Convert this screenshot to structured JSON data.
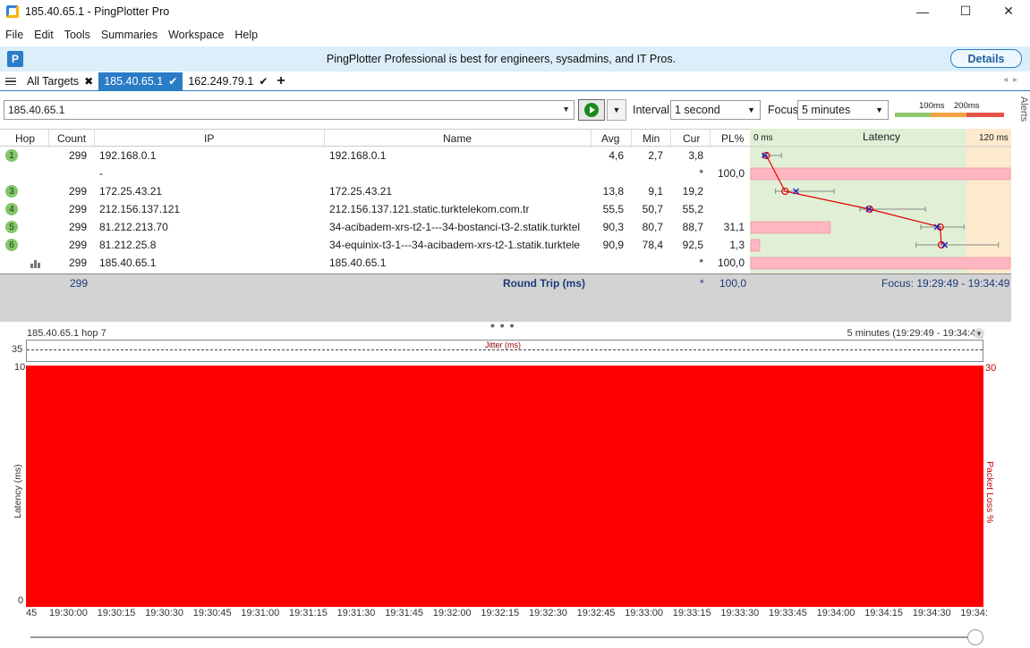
{
  "window": {
    "title": "185.40.65.1 - PingPlotter Pro",
    "minimize": "—",
    "maximize": "☐",
    "close": "✕"
  },
  "menu": [
    "File",
    "Edit",
    "Tools",
    "Summaries",
    "Workspace",
    "Help"
  ],
  "banner": {
    "text": "PingPlotter Professional is best for engineers, sysadmins, and IT Pros.",
    "button": "Details"
  },
  "tabs": {
    "all_targets": "All Targets",
    "items": [
      {
        "label": "185.40.65.1",
        "active": true
      },
      {
        "label": "162.249.79.1",
        "active": false
      }
    ],
    "add": "+"
  },
  "toolbar": {
    "target_value": "185.40.65.1",
    "interval_label": "Interval",
    "interval_value": "1 second",
    "focus_label": "Focus",
    "focus_value": "5 minutes",
    "scale_100": "100ms",
    "scale_200": "200ms",
    "alerts": "Alerts"
  },
  "columns": {
    "hop": "Hop",
    "count": "Count",
    "ip": "IP",
    "name": "Name",
    "avg": "Avg",
    "min": "Min",
    "cur": "Cur",
    "pl": "PL%",
    "latency": "Latency",
    "lat_min": "0 ms",
    "lat_max": "120 ms"
  },
  "rows": [
    {
      "hop": "1",
      "count": "299",
      "ip": "192.168.0.1",
      "name": "192.168.0.1",
      "avg": "4,6",
      "min": "2,7",
      "cur": "3,8",
      "pl": "",
      "avg_ms": 4.6,
      "min_ms": 2.7,
      "cur_ms": 3.8,
      "max_ms": 12,
      "pl_pct": 0
    },
    {
      "hop": "",
      "count": "",
      "ip": "-",
      "name": "",
      "avg": "",
      "min": "",
      "cur": "*",
      "pl": "100,0",
      "pl_pct": 100
    },
    {
      "hop": "3",
      "count": "299",
      "ip": "172.25.43.21",
      "name": "172.25.43.21",
      "avg": "13,8",
      "min": "9,1",
      "cur": "19,2",
      "pl": "",
      "avg_ms": 13.8,
      "min_ms": 9.1,
      "cur_ms": 19.2,
      "max_ms": 38,
      "pl_pct": 0
    },
    {
      "hop": "4",
      "count": "299",
      "ip": "212.156.137.121",
      "name": "212.156.137.121.static.turktelekom.com.tr",
      "avg": "55,5",
      "min": "50,7",
      "cur": "55,2",
      "pl": "",
      "avg_ms": 55.5,
      "min_ms": 50.7,
      "cur_ms": 55.2,
      "max_ms": 83,
      "pl_pct": 0
    },
    {
      "hop": "5",
      "count": "299",
      "ip": "81.212.213.70",
      "name": "34-acibadem-xrs-t2-1---34-bostanci-t3-2.statik.turktel",
      "avg": "90,3",
      "min": "80,7",
      "cur": "88,7",
      "pl": "31,1",
      "avg_ms": 90.3,
      "min_ms": 80.7,
      "cur_ms": 88.7,
      "max_ms": 102,
      "pl_pct": 31.1
    },
    {
      "hop": "6",
      "count": "299",
      "ip": "81.212.25.8",
      "name": "34-equinix-t3-1---34-acibadem-xrs-t2-1.statik.turktele",
      "avg": "90,9",
      "min": "78,4",
      "cur": "92,5",
      "pl": "1,3",
      "avg_ms": 90.9,
      "min_ms": 78.4,
      "cur_ms": 92.5,
      "max_ms": 119,
      "pl_pct": 1.3
    },
    {
      "hop": "",
      "count": "299",
      "ip": "185.40.65.1",
      "name": "185.40.65.1",
      "avg": "",
      "min": "",
      "cur": "*",
      "pl": "100,0",
      "pl_pct": 100,
      "is_target": true
    }
  ],
  "summary": {
    "count": "299",
    "label": "Round Trip (ms)",
    "cur": "*",
    "pl": "100,0",
    "focus": "Focus: 19:29:49 - 19:34:49"
  },
  "graph": {
    "title": "185.40.65.1 hop 7",
    "range": "5 minutes (19:29:49 - 19:34:49)",
    "jitter_label": "Jitter (ms)",
    "jitter_max": "35",
    "y_top": "10",
    "y_bottom": "0",
    "y_label": "Latency (ms)",
    "y2_top": "30",
    "y2_label": "Packet Loss %",
    "x_first": "45",
    "x_ticks": [
      "19:30:00",
      "19:30:15",
      "19:30:30",
      "19:30:45",
      "19:31:00",
      "19:31:15",
      "19:31:30",
      "19:31:45",
      "19:32:00",
      "19:32:15",
      "19:32:30",
      "19:32:45",
      "19:33:00",
      "19:33:15",
      "19:33:30",
      "19:33:45",
      "19:34:00",
      "19:34:15",
      "19:34:30",
      "19:34:"
    ]
  },
  "colors": {
    "accent": "#2a7cc7",
    "packet_loss": "#ff0000",
    "pl_fill": "#ffb6c1",
    "green_zone": "#e1efd6",
    "orange_zone": "#fde9cc"
  }
}
